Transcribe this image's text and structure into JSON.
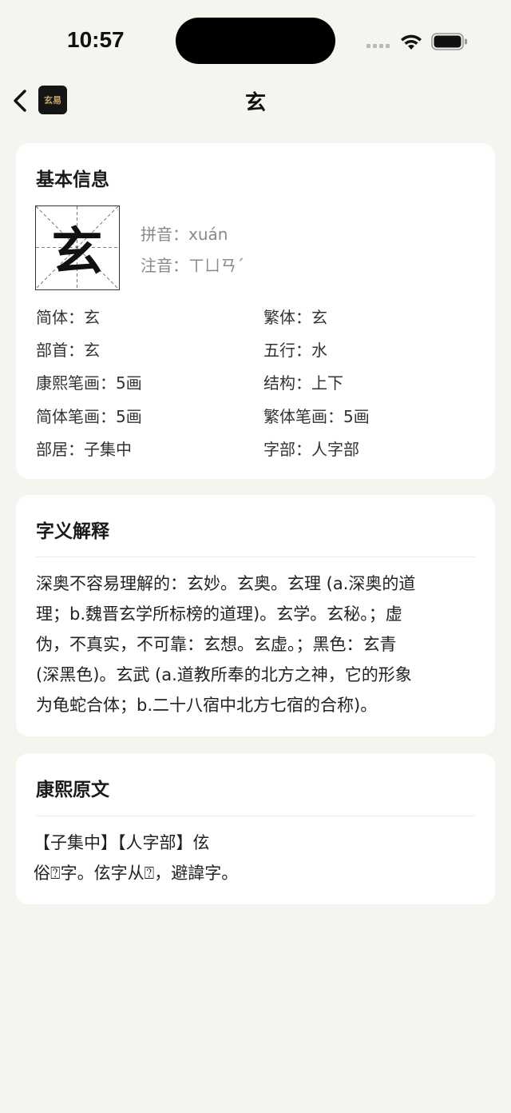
{
  "status_bar": {
    "time": "10:57"
  },
  "nav": {
    "logo_text": "玄易",
    "title": "玄"
  },
  "basic_info": {
    "title": "基本信息",
    "character": "玄",
    "pinyin_label": "拼音：",
    "pinyin": "xuán",
    "zhuyin_label": "注音：",
    "zhuyin": "ㄒㄩㄢˊ",
    "rows": [
      {
        "left": "简体：玄",
        "right": "繁体：玄"
      },
      {
        "left": "部首：玄",
        "right": "五行：水"
      },
      {
        "left": "康熙笔画：5画",
        "right": "结构：上下"
      },
      {
        "left": "简体笔画：5画",
        "right": "繁体笔画：5画"
      },
      {
        "left": "部居：子集中",
        "right": "字部：人字部"
      }
    ]
  },
  "meaning": {
    "title": "字义解释",
    "lines": [
      "深奥不容易理解的：玄妙。玄奥。玄理 (a.深奥的道",
      "理；b.魏晋玄学所标榜的道理)。玄学。玄秘。；虚",
      "伪，不真实，不可靠：玄想。玄虚。；黑色：玄青",
      "(深黑色)。玄武 (a.道教所奉的北方之神，它的形象",
      "为龟蛇合体；b.二十八宿中北方七宿的合称)。"
    ]
  },
  "kangxi": {
    "title": "康熙原文",
    "lines": [
      "【子集中】【人字部】伭",
      "俗⍰字。伭字从⍰，避諱字。"
    ]
  }
}
